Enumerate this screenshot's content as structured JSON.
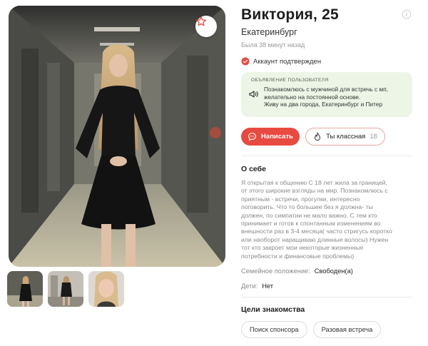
{
  "profile": {
    "name_age": "Виктория, 25",
    "city": "Екатеринбург",
    "last_seen": "Была 38 минут назад",
    "verified_label": "Аккаунт подтвержден"
  },
  "announcement": {
    "title": "ОБЪЯВЛЕНИЕ ПОЛЬЗОВАТЕЛЯ",
    "lines": [
      "Познакомлюсь с мужчиной для встречь с мп,",
      "желательно на постоянной основе.",
      "Живу на два города, Екатеринбург и Питер"
    ]
  },
  "actions": {
    "write_label": "Написать",
    "like_label": "Ты классная",
    "like_count": "18"
  },
  "about": {
    "title": "О себе",
    "lines": [
      "Я открытая к общению С 18 лет жила за границей,",
      "от этого широкие взгляды на мир. Познакомлюсь с",
      "приятным - встречи, прогулки, интересно",
      "поговорить. Что то большее без я должна- ты",
      "должен, по симпатии не мало важно. С тем кто",
      "принимает и готов к спонтанным изменениям во",
      "внешности раз в 3-4 месяца( часто стригусь коротко",
      "или наоборот наращиваю длинные волосы) Нужен",
      "тот кто закроет мои некоторые жизненные",
      "потребности и финансовые проблемы)"
    ]
  },
  "details": {
    "marital_key": "Семейное положение:",
    "marital_value": "Свободен(а)",
    "kids_key": "Дети:",
    "kids_value": "Нет"
  },
  "goals": {
    "title": "Цели знакомства",
    "tags": [
      "Поиск спонсора",
      "Разовая встреча"
    ]
  },
  "colors": {
    "accent": "#e74a40",
    "verified": "#e74a40",
    "announce_bg": "#edf6e6"
  },
  "icons": {
    "favorite": "star-icon",
    "info": "info-icon",
    "verified": "check-circle-icon",
    "announce": "megaphone-icon",
    "write": "chat-bubble-icon",
    "like": "flame-icon"
  }
}
